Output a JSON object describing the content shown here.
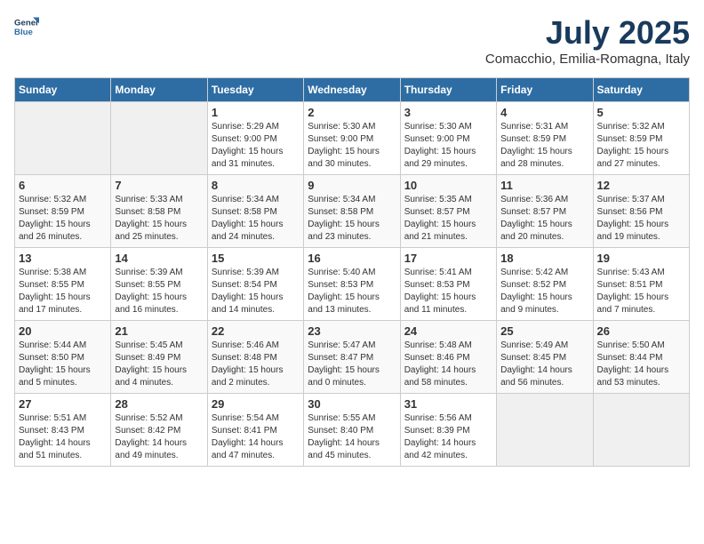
{
  "logo": {
    "line1": "General",
    "line2": "Blue"
  },
  "title": "July 2025",
  "location": "Comacchio, Emilia-Romagna, Italy",
  "headers": [
    "Sunday",
    "Monday",
    "Tuesday",
    "Wednesday",
    "Thursday",
    "Friday",
    "Saturday"
  ],
  "weeks": [
    [
      {
        "day": "",
        "info": ""
      },
      {
        "day": "",
        "info": ""
      },
      {
        "day": "1",
        "info": "Sunrise: 5:29 AM\nSunset: 9:00 PM\nDaylight: 15 hours\nand 31 minutes."
      },
      {
        "day": "2",
        "info": "Sunrise: 5:30 AM\nSunset: 9:00 PM\nDaylight: 15 hours\nand 30 minutes."
      },
      {
        "day": "3",
        "info": "Sunrise: 5:30 AM\nSunset: 9:00 PM\nDaylight: 15 hours\nand 29 minutes."
      },
      {
        "day": "4",
        "info": "Sunrise: 5:31 AM\nSunset: 8:59 PM\nDaylight: 15 hours\nand 28 minutes."
      },
      {
        "day": "5",
        "info": "Sunrise: 5:32 AM\nSunset: 8:59 PM\nDaylight: 15 hours\nand 27 minutes."
      }
    ],
    [
      {
        "day": "6",
        "info": "Sunrise: 5:32 AM\nSunset: 8:59 PM\nDaylight: 15 hours\nand 26 minutes."
      },
      {
        "day": "7",
        "info": "Sunrise: 5:33 AM\nSunset: 8:58 PM\nDaylight: 15 hours\nand 25 minutes."
      },
      {
        "day": "8",
        "info": "Sunrise: 5:34 AM\nSunset: 8:58 PM\nDaylight: 15 hours\nand 24 minutes."
      },
      {
        "day": "9",
        "info": "Sunrise: 5:34 AM\nSunset: 8:58 PM\nDaylight: 15 hours\nand 23 minutes."
      },
      {
        "day": "10",
        "info": "Sunrise: 5:35 AM\nSunset: 8:57 PM\nDaylight: 15 hours\nand 21 minutes."
      },
      {
        "day": "11",
        "info": "Sunrise: 5:36 AM\nSunset: 8:57 PM\nDaylight: 15 hours\nand 20 minutes."
      },
      {
        "day": "12",
        "info": "Sunrise: 5:37 AM\nSunset: 8:56 PM\nDaylight: 15 hours\nand 19 minutes."
      }
    ],
    [
      {
        "day": "13",
        "info": "Sunrise: 5:38 AM\nSunset: 8:55 PM\nDaylight: 15 hours\nand 17 minutes."
      },
      {
        "day": "14",
        "info": "Sunrise: 5:39 AM\nSunset: 8:55 PM\nDaylight: 15 hours\nand 16 minutes."
      },
      {
        "day": "15",
        "info": "Sunrise: 5:39 AM\nSunset: 8:54 PM\nDaylight: 15 hours\nand 14 minutes."
      },
      {
        "day": "16",
        "info": "Sunrise: 5:40 AM\nSunset: 8:53 PM\nDaylight: 15 hours\nand 13 minutes."
      },
      {
        "day": "17",
        "info": "Sunrise: 5:41 AM\nSunset: 8:53 PM\nDaylight: 15 hours\nand 11 minutes."
      },
      {
        "day": "18",
        "info": "Sunrise: 5:42 AM\nSunset: 8:52 PM\nDaylight: 15 hours\nand 9 minutes."
      },
      {
        "day": "19",
        "info": "Sunrise: 5:43 AM\nSunset: 8:51 PM\nDaylight: 15 hours\nand 7 minutes."
      }
    ],
    [
      {
        "day": "20",
        "info": "Sunrise: 5:44 AM\nSunset: 8:50 PM\nDaylight: 15 hours\nand 5 minutes."
      },
      {
        "day": "21",
        "info": "Sunrise: 5:45 AM\nSunset: 8:49 PM\nDaylight: 15 hours\nand 4 minutes."
      },
      {
        "day": "22",
        "info": "Sunrise: 5:46 AM\nSunset: 8:48 PM\nDaylight: 15 hours\nand 2 minutes."
      },
      {
        "day": "23",
        "info": "Sunrise: 5:47 AM\nSunset: 8:47 PM\nDaylight: 15 hours\nand 0 minutes."
      },
      {
        "day": "24",
        "info": "Sunrise: 5:48 AM\nSunset: 8:46 PM\nDaylight: 14 hours\nand 58 minutes."
      },
      {
        "day": "25",
        "info": "Sunrise: 5:49 AM\nSunset: 8:45 PM\nDaylight: 14 hours\nand 56 minutes."
      },
      {
        "day": "26",
        "info": "Sunrise: 5:50 AM\nSunset: 8:44 PM\nDaylight: 14 hours\nand 53 minutes."
      }
    ],
    [
      {
        "day": "27",
        "info": "Sunrise: 5:51 AM\nSunset: 8:43 PM\nDaylight: 14 hours\nand 51 minutes."
      },
      {
        "day": "28",
        "info": "Sunrise: 5:52 AM\nSunset: 8:42 PM\nDaylight: 14 hours\nand 49 minutes."
      },
      {
        "day": "29",
        "info": "Sunrise: 5:54 AM\nSunset: 8:41 PM\nDaylight: 14 hours\nand 47 minutes."
      },
      {
        "day": "30",
        "info": "Sunrise: 5:55 AM\nSunset: 8:40 PM\nDaylight: 14 hours\nand 45 minutes."
      },
      {
        "day": "31",
        "info": "Sunrise: 5:56 AM\nSunset: 8:39 PM\nDaylight: 14 hours\nand 42 minutes."
      },
      {
        "day": "",
        "info": ""
      },
      {
        "day": "",
        "info": ""
      }
    ]
  ]
}
